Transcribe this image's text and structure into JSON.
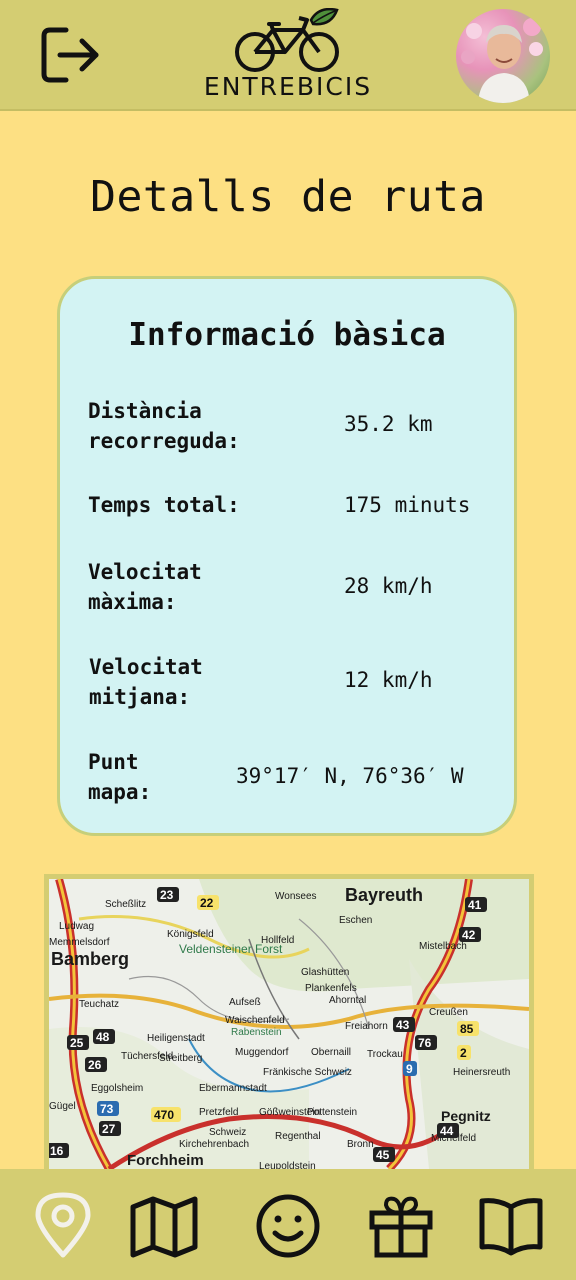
{
  "header": {
    "logo_text": "ENTREBICIS",
    "logout_icon": "logout-icon",
    "logo_icon": "bicycle-leaf-icon",
    "avatar": "user-avatar"
  },
  "page": {
    "title": "Detalls de ruta"
  },
  "info": {
    "title": "Informació bàsica",
    "rows": [
      {
        "label": "Distància recorreguda:",
        "value": "35.2 km"
      },
      {
        "label": "Temps total:",
        "value": "175 minuts"
      },
      {
        "label": "Velocitat màxima:",
        "value": "28 km/h"
      },
      {
        "label": "Velocitat mitjana:",
        "value": "12 km/h"
      },
      {
        "label": "Punt mapa:",
        "value": "39°17′ N, 76°36′ W"
      }
    ]
  },
  "map": {
    "labels": [
      "Bayreuth",
      "Bamberg",
      "Forchheim",
      "Pegnitz",
      "Veldensteiner Forst",
      "Aufseß",
      "Hollfeld",
      "Glashütten",
      "Ahorntal",
      "Creußen",
      "Rabenstein",
      "Muggendorf",
      "Pretzfeld",
      "Gößweinstein",
      "Pottenstein",
      "Ebermannstadt",
      "Heiligenstadt",
      "Streitberg",
      "Tüchersfeld",
      "Waischenfeld",
      "Fränkische Schweiz",
      "Mistelbach",
      "Plankenfels",
      "Michelfeld",
      "Kirchehrenbach",
      "Leupoldstein",
      "Regenthal",
      "Trockau",
      "Heinersreuth",
      "Eggolsheim",
      "Gügel",
      "Ludwag",
      "Memmelsdorf",
      "Scheßlitz",
      "Königsfeld",
      "Freiahorn",
      "Teuchatz",
      "Wonsees",
      "Eschen",
      "Obernaill",
      "Schweiz",
      "Bronn"
    ],
    "road_numbers": [
      "22",
      "48",
      "73",
      "470",
      "25",
      "26",
      "27",
      "41",
      "42",
      "43",
      "44",
      "45",
      "9",
      "76",
      "2",
      "85",
      "16",
      "23"
    ]
  },
  "nav": [
    "location-pin-icon",
    "map-icon",
    "smiley-icon",
    "gift-icon",
    "book-icon"
  ],
  "colors": {
    "background": "#fde083",
    "header": "#d4cd72",
    "card": "#d3f3f3",
    "card_border": "#c6cf7a"
  }
}
